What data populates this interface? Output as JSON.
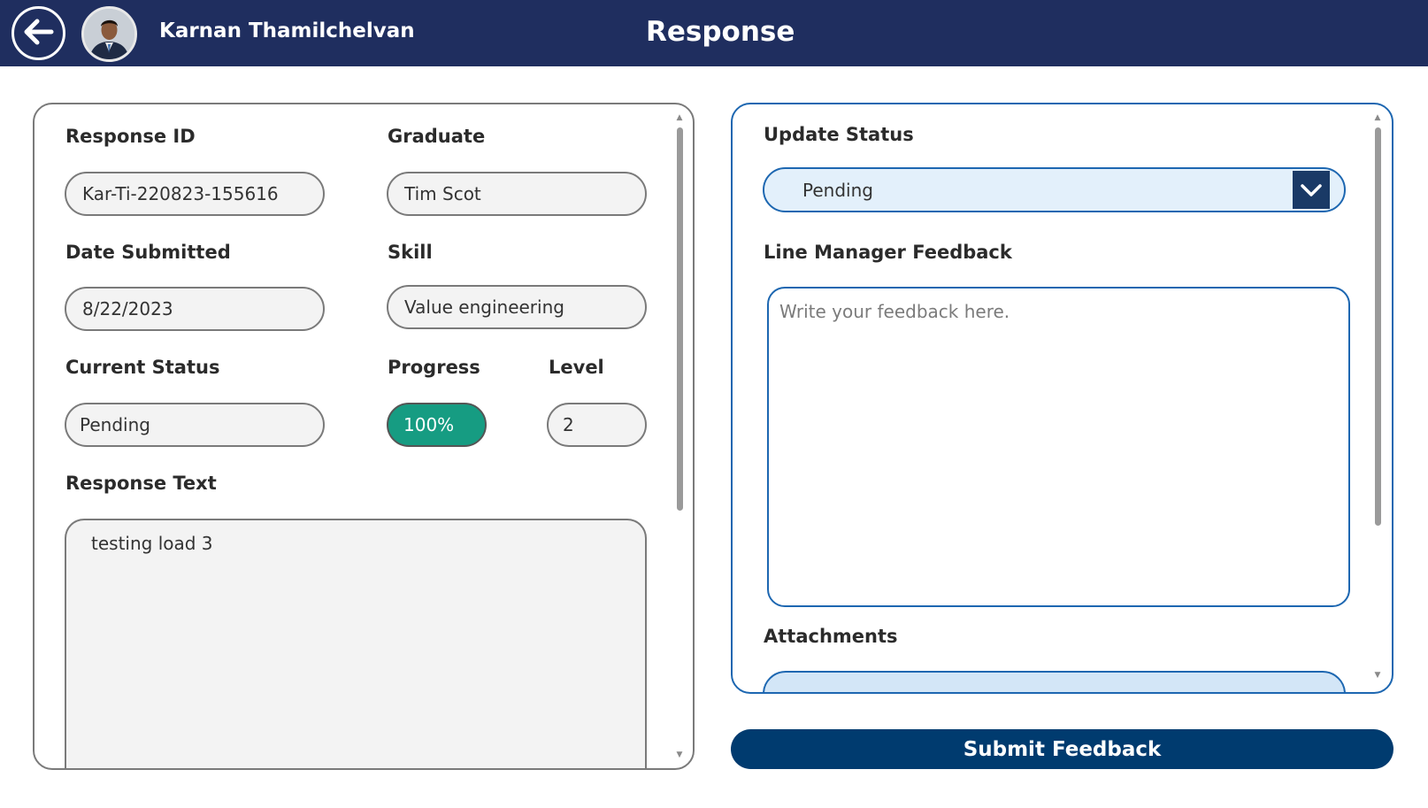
{
  "header": {
    "user_name": "Karnan Thamilchelvan",
    "title": "Response",
    "back_icon": "arrow-left-icon",
    "background_color": "#1f2e5f"
  },
  "details": {
    "response_id": {
      "label": "Response ID",
      "value": "Kar-Ti-220823-155616"
    },
    "graduate": {
      "label": "Graduate",
      "value": "Tim Scot"
    },
    "date_submitted": {
      "label": "Date Submitted",
      "value": "8/22/2023"
    },
    "skill": {
      "label": "Skill",
      "value": "Value engineering"
    },
    "current_status": {
      "label": "Current Status",
      "value": "Pending"
    },
    "progress": {
      "label": "Progress",
      "value": "100%",
      "color": "#169c82"
    },
    "level": {
      "label": "Level",
      "value": "2"
    },
    "response_text": {
      "label": "Response Text",
      "value": "testing load 3"
    }
  },
  "feedback": {
    "update_status": {
      "label": "Update Status",
      "selected": "Pending"
    },
    "line_manager_feedback": {
      "label": "Line Manager Feedback",
      "placeholder": "Write your feedback here.",
      "value": ""
    },
    "attachments": {
      "label": "Attachments"
    }
  },
  "submit": {
    "label": "Submit Feedback",
    "color": "#003b6f"
  }
}
